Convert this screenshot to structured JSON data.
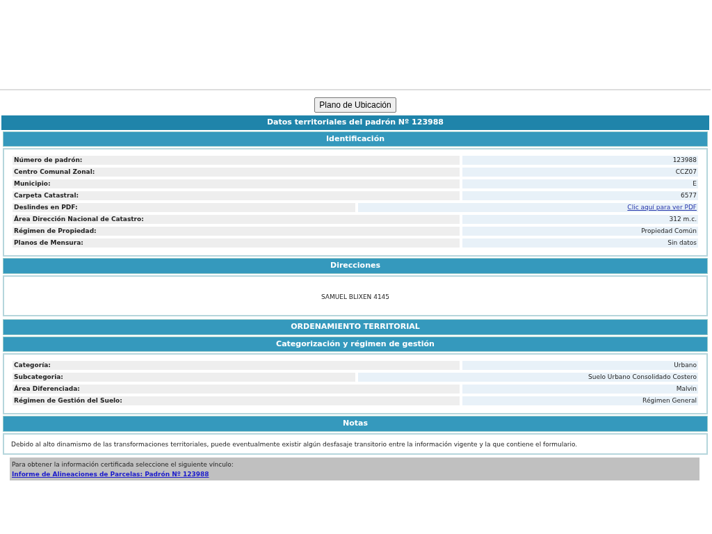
{
  "plan_button": "Plano de Ubicación",
  "title": "Datos territoriales del padrón Nº 123988",
  "identificacion": {
    "heading": "Identificación",
    "rows": [
      {
        "label": "Número de padrón:",
        "value": "123988",
        "kind": "text"
      },
      {
        "label": "Centro Comunal Zonal:",
        "value": "CCZ07",
        "kind": "text"
      },
      {
        "label": "Municipio:",
        "value": "E",
        "kind": "text"
      },
      {
        "label": "Carpeta Catastral:",
        "value": "6577",
        "kind": "text"
      },
      {
        "label": "Deslindes en PDF:",
        "value": "Clic aquí para ver PDF",
        "kind": "link"
      },
      {
        "label": "Área Dirección Nacional de Catastro:",
        "value": "312 m.c.",
        "kind": "text"
      },
      {
        "label": "Régimen de Propiedad:",
        "value": "Propiedad Común",
        "kind": "text"
      },
      {
        "label": "Planos de Mensura:",
        "value": "Sin datos",
        "kind": "text"
      }
    ]
  },
  "direcciones": {
    "heading": "Direcciones",
    "address": "SAMUEL BLIXEN 4145"
  },
  "ordenamiento": {
    "heading": "ORDENAMIENTO TERRITORIAL"
  },
  "categorizacion": {
    "heading": "Categorización y régimen de gestión",
    "rows": [
      {
        "label": "Categoría:",
        "value": "Urbano",
        "kind": "text"
      },
      {
        "label": "Subcategoria:",
        "value": "Suelo Urbano Consolidado Costero",
        "kind": "wide"
      },
      {
        "label": "Área Diferenciada:",
        "value": "Malvin",
        "kind": "text"
      },
      {
        "label": "Régimen de Gestión del Suelo:",
        "value": "Régimen General",
        "kind": "text"
      }
    ]
  },
  "notas": {
    "heading": "Notas",
    "text": "Debido al alto dinamismo de las transformaciones territoriales, puede eventualmente existir algún desfasaje transitorio entre la información vigente y la que contiene el formulario."
  },
  "certificado": {
    "text": "Para obtener la información certificada seleccione el siguiente vínculo:",
    "link": "Informe de Alineaciones de Parcelas: Padrón Nº 123988"
  }
}
